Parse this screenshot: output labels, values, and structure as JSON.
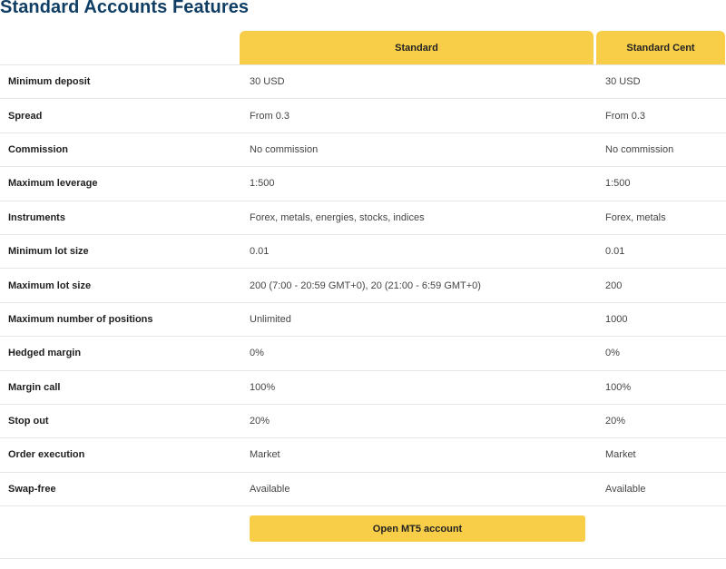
{
  "title": "Standard Accounts Features",
  "columns": [
    "Standard",
    "Standard Cent"
  ],
  "rows": [
    {
      "label": "Minimum deposit",
      "standard": "30 USD",
      "cent": "30 USD"
    },
    {
      "label": "Spread",
      "standard": "From 0.3",
      "cent": "From 0.3"
    },
    {
      "label": "Commission",
      "standard": "No commission",
      "cent": "No commission"
    },
    {
      "label": "Maximum leverage",
      "standard": "1:500",
      "cent": "1:500"
    },
    {
      "label": "Instruments",
      "standard": "Forex, metals, energies, stocks, indices",
      "cent": "Forex, metals"
    },
    {
      "label": "Minimum lot size",
      "standard": "0.01",
      "cent": "0.01"
    },
    {
      "label": "Maximum lot size",
      "standard": "200 (7:00 - 20:59 GMT+0), 20 (21:00 - 6:59 GMT+0)",
      "cent": "200"
    },
    {
      "label": "Maximum number of positions",
      "standard": "Unlimited",
      "cent": "1000"
    },
    {
      "label": "Hedged margin",
      "standard": "0%",
      "cent": "0%"
    },
    {
      "label": "Margin call",
      "standard": "100%",
      "cent": "100%"
    },
    {
      "label": "Stop out",
      "standard": "20%",
      "cent": "20%"
    },
    {
      "label": "Order execution",
      "standard": "Market",
      "cent": "Market"
    },
    {
      "label": "Swap-free",
      "standard": "Available",
      "cent": "Available"
    }
  ],
  "cta": {
    "label": "Open MT5 account"
  },
  "colors": {
    "accent": "#f8ce48",
    "title": "#0f3d63",
    "divider": "#e6e6e6"
  }
}
